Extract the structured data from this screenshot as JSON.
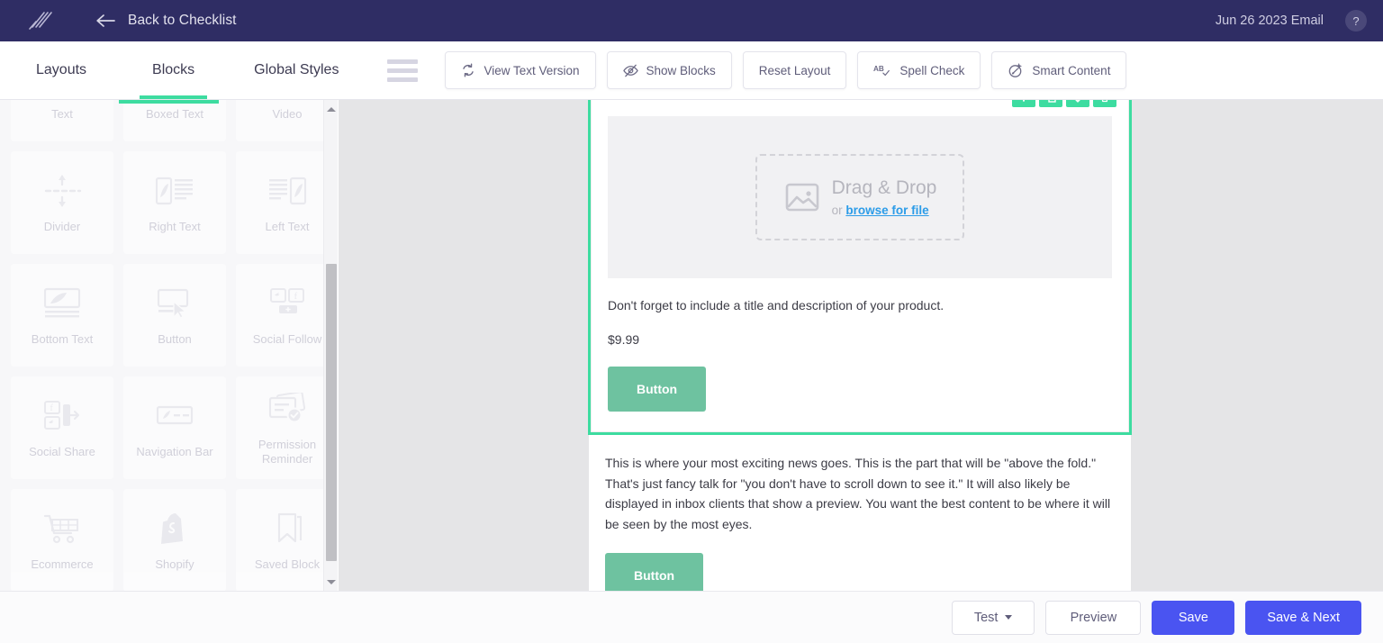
{
  "header": {
    "logo_icon": "slash-logo-icon",
    "back_arrow_icon": "arrow-left-icon",
    "back_label": "Back to Checklist",
    "email_name": "Jun 26 2023 Email",
    "help_label": "?",
    "bg_color": "#2f2d64"
  },
  "toolbar": {
    "tabs": [
      {
        "label": "Layouts",
        "active": false
      },
      {
        "label": "Blocks",
        "active": true
      },
      {
        "label": "Global Styles",
        "active": false
      }
    ],
    "menu_icon": "hamburger-menu-icon",
    "buttons": [
      {
        "label": "View Text Version",
        "icon": "refresh-cycle-icon"
      },
      {
        "label": "Show Blocks",
        "icon": "eye-slash-icon"
      },
      {
        "label": "Reset Layout",
        "icon": "none"
      },
      {
        "label": "Spell Check",
        "icon": "ab-check-icon"
      },
      {
        "label": "Smart Content",
        "icon": "smart-content-icon"
      }
    ],
    "active_accent": "#3ddca0"
  },
  "palette": {
    "blocks": [
      {
        "label": "Text",
        "icon": "text-block-icon"
      },
      {
        "label": "Boxed Text",
        "icon": "boxed-text-icon"
      },
      {
        "label": "Video",
        "icon": "video-icon"
      },
      {
        "label": "Divider",
        "icon": "divider-icon"
      },
      {
        "label": "Right Text",
        "icon": "right-text-icon"
      },
      {
        "label": "Left Text",
        "icon": "left-text-icon"
      },
      {
        "label": "Bottom Text",
        "icon": "bottom-text-icon"
      },
      {
        "label": "Button",
        "icon": "button-icon"
      },
      {
        "label": "Social Follow",
        "icon": "social-follow-icon"
      },
      {
        "label": "Social Share",
        "icon": "social-share-icon"
      },
      {
        "label": "Navigation Bar",
        "icon": "navigation-bar-icon"
      },
      {
        "label": "Permission Reminder",
        "icon": "permission-reminder-icon"
      },
      {
        "label": "Ecommerce",
        "icon": "shopping-cart-icon"
      },
      {
        "label": "Shopify",
        "icon": "shopify-bag-icon"
      },
      {
        "label": "Saved Block",
        "icon": "bookmark-icon"
      }
    ],
    "scroll_up_icon": "scroll-up-arrow-icon",
    "scroll_down_icon": "scroll-down-arrow-icon"
  },
  "canvas": {
    "selection_color": "#3ddca0",
    "block_toolbar": [
      {
        "icon": "add-icon"
      },
      {
        "icon": "duplicate-icon"
      },
      {
        "icon": "move-icon"
      },
      {
        "icon": "delete-icon"
      }
    ],
    "product_block": {
      "dropzone_title": "Drag & Drop",
      "dropzone_or": "or ",
      "dropzone_link": "browse for file",
      "dropzone_icon": "image-placeholder-icon",
      "description": "Don't forget to include a title and description of your product.",
      "price": "$9.99",
      "button_label": "Button",
      "button_color": "#6ec2a0"
    },
    "news_block": {
      "text": "This is where your most exciting news goes. This is the part that will be \"above the fold.\" That's just fancy talk for \"you don't have to scroll down to see it.\" It will also likely be displayed in inbox clients that show a preview. You want the best content to be where it will be seen by the most eyes.",
      "button_label": "Button"
    }
  },
  "footer": {
    "test_label": "Test",
    "preview_label": "Preview",
    "save_label": "Save",
    "save_next_label": "Save & Next",
    "primary_color": "#4a54f1"
  }
}
